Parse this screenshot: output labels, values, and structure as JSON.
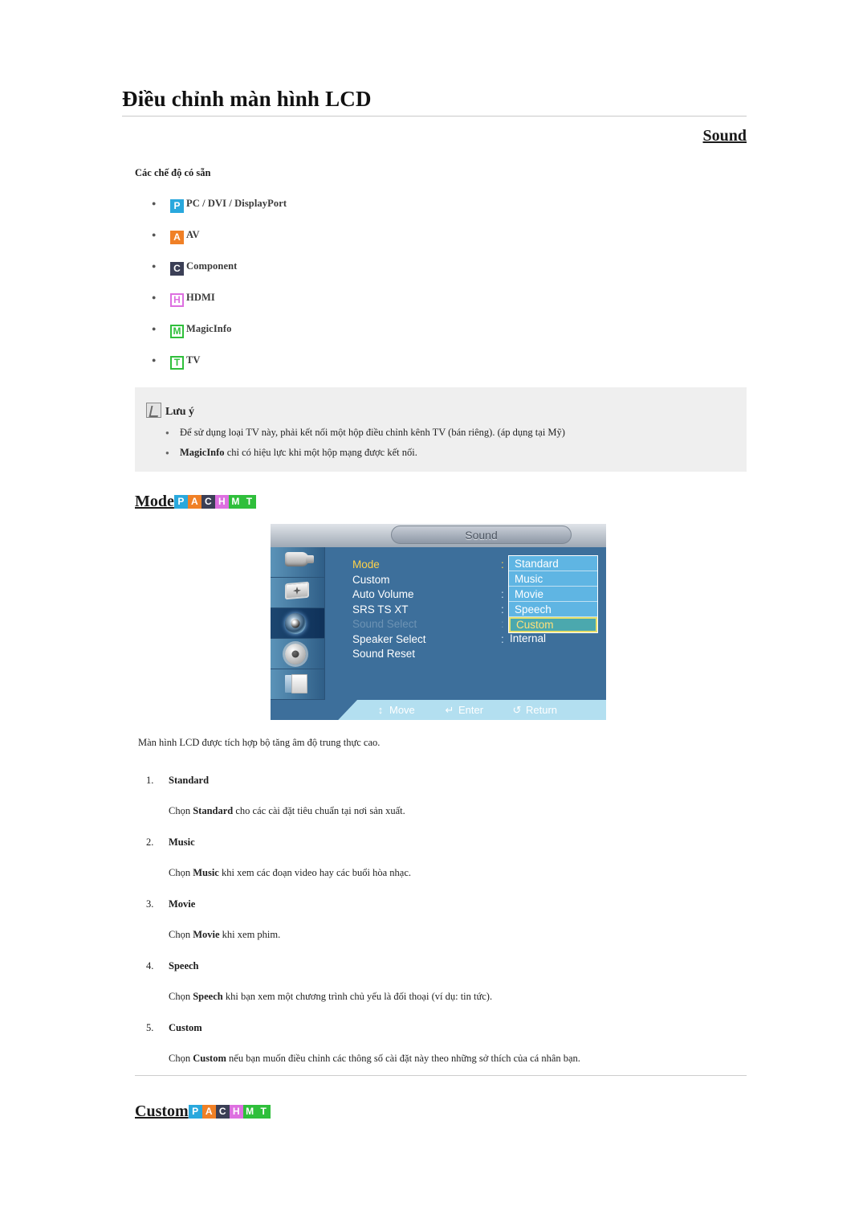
{
  "header": {
    "title": "Điều chỉnh màn hình LCD",
    "anchor": "Sound"
  },
  "available_modes": {
    "heading": "Các chế độ có sẵn",
    "items": [
      {
        "badge": "P",
        "label": "PC / DVI / DisplayPort",
        "color": "#29a8dd"
      },
      {
        "badge": "A",
        "label": "AV",
        "color": "#f08026"
      },
      {
        "badge": "C",
        "label": "Component",
        "color": "#3b3f56"
      },
      {
        "badge": "H",
        "label": "HDMI",
        "color": "#dd6fe0"
      },
      {
        "badge": "M",
        "label": "MagicInfo",
        "color": "#2fbf3b"
      },
      {
        "badge": "T",
        "label": "TV",
        "color": "#2fbf3b"
      }
    ]
  },
  "note": {
    "icon": "note-pen-icon",
    "title": "Lưu ý",
    "items": [
      "Để sử dụng loại TV này, phải kết nối một hộp điều chỉnh kênh TV (bán riêng). (áp dụng tại Mỹ)",
      "MagicInfo chỉ có hiệu lực khi một hộp mạng được kết nối."
    ],
    "item2_bold": "MagicInfo",
    "item2_rest": " chỉ có hiệu lực khi một hộp mạng được kết nối."
  },
  "headings": {
    "mode": "Mode",
    "custom": "Custom",
    "badges": [
      "P",
      "A",
      "C",
      "H",
      "M",
      "T"
    ]
  },
  "osd": {
    "title": "Sound",
    "sidebar_icons": [
      "input-plug-icon",
      "picture-screen-icon",
      "sound-speaker-icon",
      "setup-gear-icon",
      "multi-control-page-icon"
    ],
    "menu_items": [
      {
        "label": "Mode",
        "state": "active",
        "colon": ":"
      },
      {
        "label": "Custom",
        "state": "normal",
        "colon": ""
      },
      {
        "label": "Auto Volume",
        "state": "normal",
        "colon": ":"
      },
      {
        "label": "SRS TS XT",
        "state": "normal",
        "colon": ":"
      },
      {
        "label": "Sound Select",
        "state": "disabled",
        "colon": ":"
      },
      {
        "label": "Speaker Select",
        "state": "normal",
        "colon": ":"
      },
      {
        "label": "Sound Reset",
        "state": "normal",
        "colon": ""
      }
    ],
    "speaker_value": "Internal",
    "dropdown": [
      {
        "label": "Standard",
        "selected": false
      },
      {
        "label": "Music",
        "selected": false
      },
      {
        "label": "Movie",
        "selected": false
      },
      {
        "label": "Speech",
        "selected": false
      },
      {
        "label": "Custom",
        "selected": true
      }
    ],
    "hints": [
      {
        "icon": "↕",
        "label": "Move"
      },
      {
        "icon": "↵",
        "label": "Enter"
      },
      {
        "icon": "↺",
        "label": "Return"
      }
    ],
    "colors": {
      "body": "#3d6f9b",
      "dropdown": "#5fb5e3",
      "selected": "#4ba8ae",
      "selected_text": "#ffe07a",
      "active_text": "#ffd24a",
      "bottom_bar": "#b3dff0"
    }
  },
  "body": {
    "intro": "Màn hình LCD được tích hợp bộ tăng âm độ trung thực cao.",
    "items": [
      {
        "num": "1.",
        "title": "Standard",
        "desc_pre": "Chọn ",
        "desc_bold": "Standard",
        "desc_post": " cho các cài đặt tiêu chuẩn tại nơi sản xuất."
      },
      {
        "num": "2.",
        "title": "Music",
        "desc_pre": "Chọn ",
        "desc_bold": "Music",
        "desc_post": " khi xem các đoạn video hay các buổi hòa nhạc."
      },
      {
        "num": "3.",
        "title": "Movie",
        "desc_pre": "Chọn ",
        "desc_bold": "Movie",
        "desc_post": " khi xem phim."
      },
      {
        "num": "4.",
        "title": "Speech",
        "desc_pre": "Chọn ",
        "desc_bold": "Speech",
        "desc_post": " khi bạn xem một chương trình chủ yếu là đối thoại (ví dụ: tin tức)."
      },
      {
        "num": "5.",
        "title": "Custom",
        "desc_pre": "Chọn ",
        "desc_bold": "Custom",
        "desc_post": " nếu bạn muốn điều chỉnh các thông số cài đặt này theo những sở thích của cá nhân bạn."
      }
    ]
  }
}
